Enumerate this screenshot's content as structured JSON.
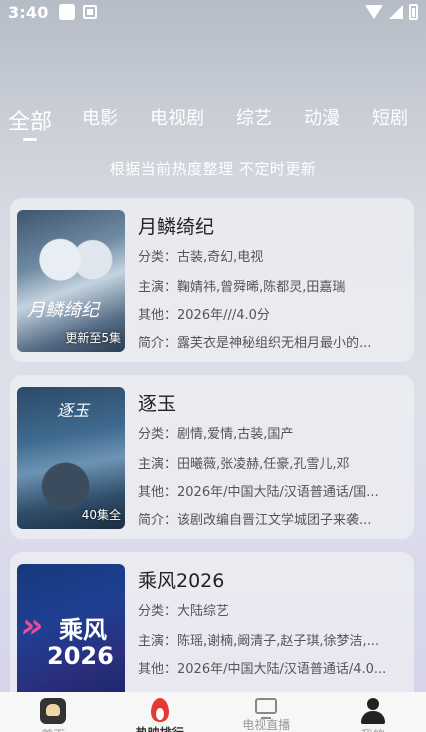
{
  "status_bar": {
    "time": "3:40"
  },
  "tabs": [
    {
      "label": "全部",
      "active": true
    },
    {
      "label": "电影"
    },
    {
      "label": "电视剧"
    },
    {
      "label": "综艺"
    },
    {
      "label": "动漫"
    },
    {
      "label": "短剧"
    }
  ],
  "subtitle": "根据当前热度整理 不定时更新",
  "cards": [
    {
      "title": "月鳞绮纪",
      "poster_title": "月鳞绮纪",
      "badge": "更新至5集",
      "genre": "分类：古装,奇幻,电视",
      "cast": "主演：鞠婧祎,曾舜晞,陈都灵,田嘉瑞",
      "other": "其他：2026年///4.0分",
      "intro": "简介：露芙衣是神秘组织无相月最小的..."
    },
    {
      "title": "逐玉",
      "poster_title": "逐玉",
      "badge": "40集全",
      "genre": "分类：剧情,爱情,古装,国产",
      "cast": "主演：田曦薇,张凌赫,任豪,孔雪儿,邓",
      "other": "其他：2026年/中国大陆/汉语普通话/国...",
      "intro": "简介：该剧改编自晋江文学城团子来袭..."
    },
    {
      "title": "乘风2026",
      "poster_logo": "乘风",
      "poster_year": "2026",
      "genre": "分类：大陆综艺",
      "cast": "主演：陈瑶,谢楠,阚清子,赵子琪,徐梦洁,...",
      "other": "其他：2026年/中国大陆/汉语普通话/4.0..."
    }
  ],
  "bottom_nav": [
    {
      "label": "首页",
      "icon": "home-icon"
    },
    {
      "label": "热映排行",
      "icon": "fire-icon",
      "active": true
    },
    {
      "label": "电视直播",
      "icon": "tv-icon"
    },
    {
      "label": "我的",
      "icon": "person-icon"
    }
  ]
}
